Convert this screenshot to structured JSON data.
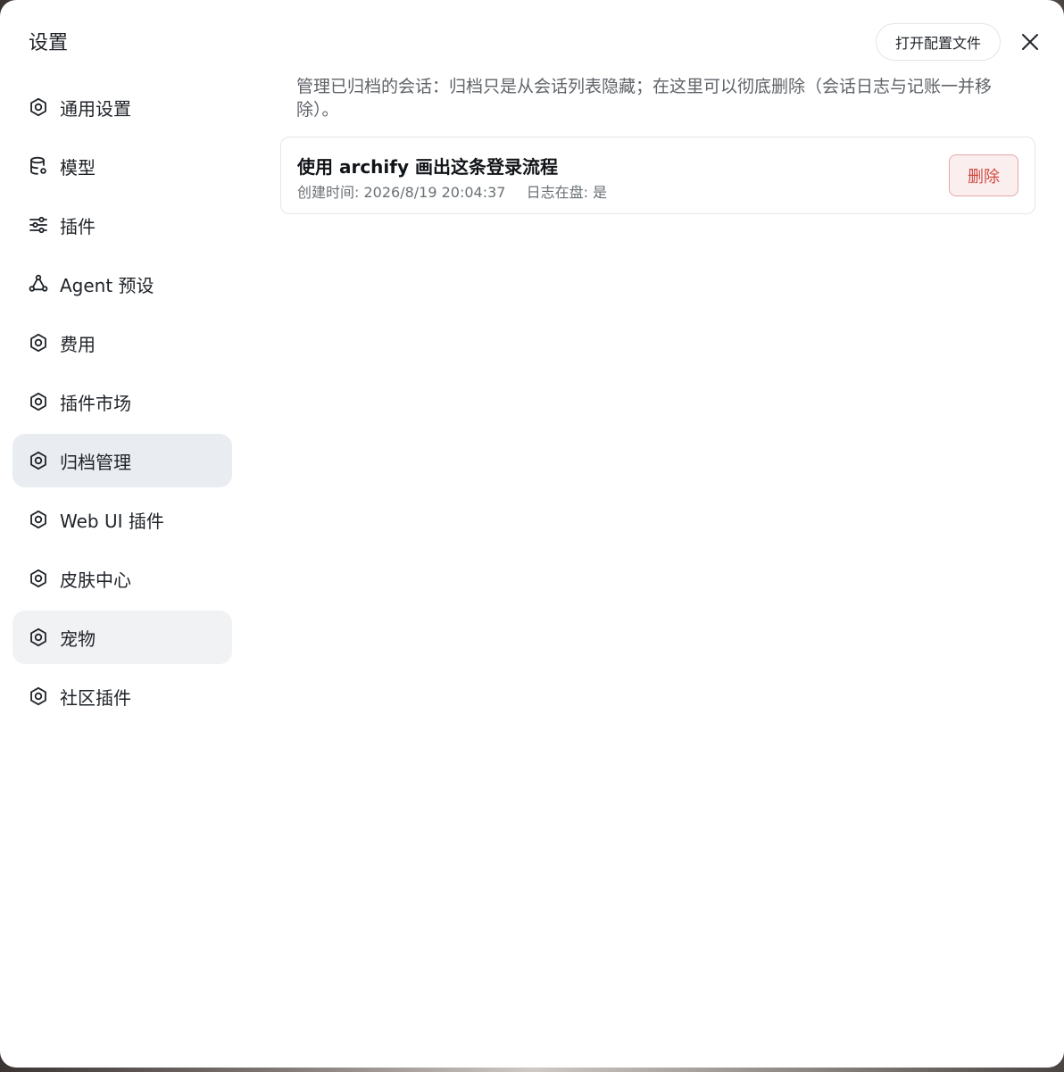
{
  "dialog": {
    "title": "设置",
    "open_config_label": "打开配置文件"
  },
  "sidebar": {
    "items": [
      {
        "label": "通用设置",
        "icon": "gear-icon"
      },
      {
        "label": "模型",
        "icon": "database-icon"
      },
      {
        "label": "插件",
        "icon": "sliders-icon"
      },
      {
        "label": "Agent 预设",
        "icon": "agent-network-icon"
      },
      {
        "label": "费用",
        "icon": "gear-icon"
      },
      {
        "label": "插件市场",
        "icon": "gear-icon"
      },
      {
        "label": "归档管理",
        "icon": "gear-icon",
        "state": "selected"
      },
      {
        "label": "Web UI 插件",
        "icon": "gear-icon"
      },
      {
        "label": "皮肤中心",
        "icon": "gear-icon"
      },
      {
        "label": "宠物",
        "icon": "gear-icon",
        "state": "hovered"
      },
      {
        "label": "社区插件",
        "icon": "gear-icon"
      }
    ]
  },
  "archive": {
    "description": "管理已归档的会话：归档只是从会话列表隐藏；在这里可以彻底删除（会话日志与记账一并移除）。",
    "sessions": [
      {
        "title": "使用 archify 画出这条登录流程",
        "created": "创建时间: 2026/8/19 20:04:37",
        "log_on_disk": "日志在盘: 是",
        "delete_label": "删除"
      }
    ]
  },
  "colors": {
    "selected_bg": "#e9ecf0",
    "hover_bg": "#f1f2f4",
    "danger_text": "#d0493f",
    "danger_bg": "#fbeeee"
  }
}
